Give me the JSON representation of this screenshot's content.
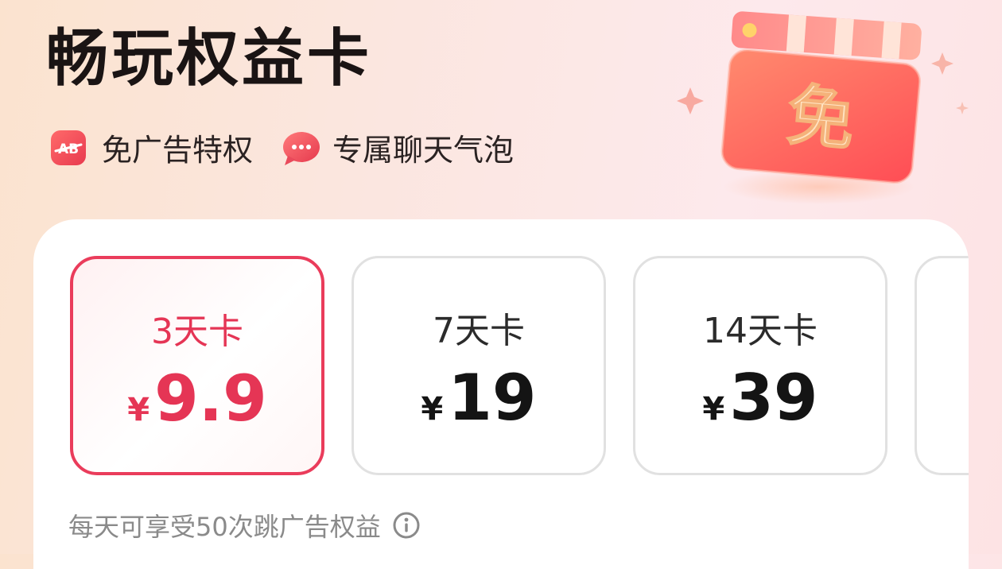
{
  "header": {
    "title": "畅玩权益卡"
  },
  "perks": [
    {
      "icon": "ad-block-icon",
      "label": "免广告特权"
    },
    {
      "icon": "chat-bubble-icon",
      "label": "专属聊天气泡"
    }
  ],
  "hero": {
    "badge_text": "免"
  },
  "plans": [
    {
      "name": "3天卡",
      "currency": "¥",
      "price": "9.9",
      "selected": true
    },
    {
      "name": "7天卡",
      "currency": "¥",
      "price": "19",
      "selected": false
    },
    {
      "name": "14天卡",
      "currency": "¥",
      "price": "39",
      "selected": false
    }
  ],
  "note": {
    "text": "每天可享受50次跳广告权益",
    "icon": "info-icon"
  },
  "colors": {
    "accent": "#e53555",
    "title": "#1a1414",
    "muted": "#8a8a8a"
  }
}
